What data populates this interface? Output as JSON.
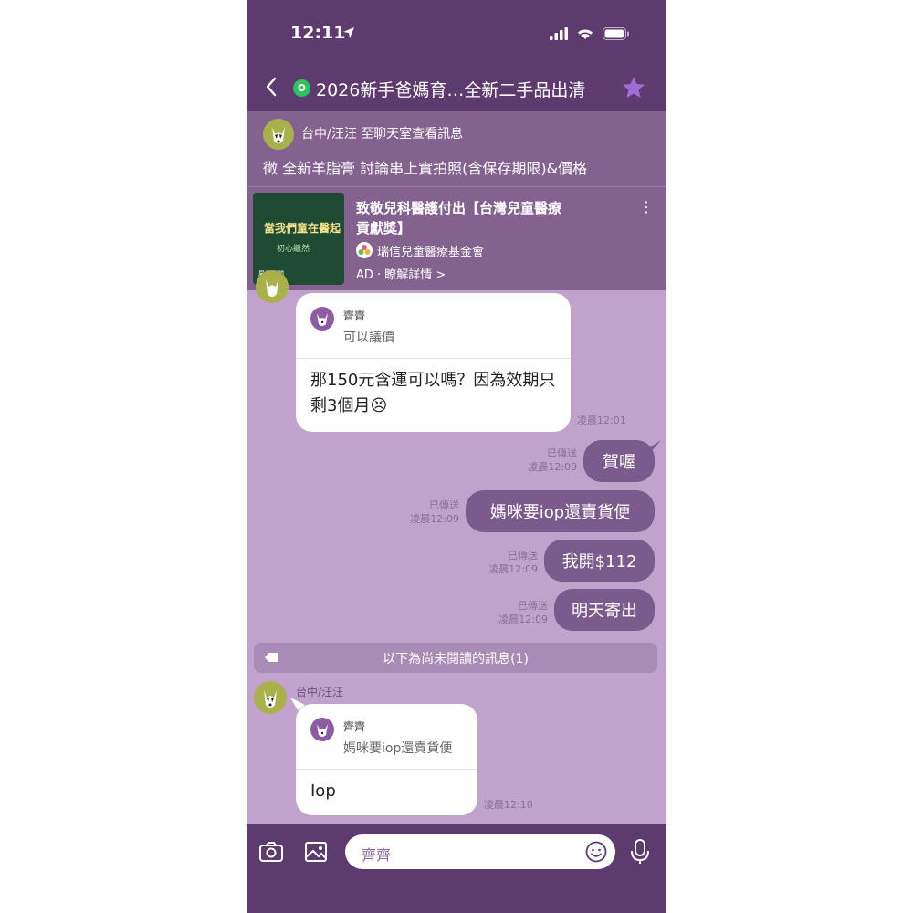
{
  "status_bar": {
    "time": "12:11"
  },
  "header": {
    "title": "2026新手爸媽育…全新二手品出清"
  },
  "announcement": {
    "sender": "台中/汪汪 至聊天室查看訊息",
    "text": "徵 全新羊脂膏 討論串上實拍照(含保存期限)&價格"
  },
  "ad": {
    "thumb_title": "當我們童在醫起",
    "thumb_sub": "初心繼然",
    "thumb_info": "展件期間",
    "headline": "致敬兒科醫護付出【台灣兒童醫療貢獻獎】",
    "sponsor": "瑞信兒童醫療基金會",
    "label": "AD · 瞭解詳情 >",
    "more": "⋮"
  },
  "messages": {
    "m1": {
      "reply_name": "齊齊",
      "reply_text": "可以議價",
      "text": "那150元含運可以嗎？因為效期只剩3個月😣",
      "time": "凌晨12:01"
    },
    "o1": {
      "text": "賀喔",
      "read": "已傳送",
      "time": "凌晨12:09"
    },
    "o2": {
      "text": "媽咪要iop還賣貨便",
      "read": "已傳送",
      "time": "凌晨12:09"
    },
    "o3": {
      "text": "我開$112",
      "read": "已傳送",
      "time": "凌晨12:09"
    },
    "o4": {
      "text": "明天寄出",
      "read": "已傳送",
      "time": "凌晨12:09"
    },
    "unread_divider": "以下為尚未閱讀的訊息(1)",
    "m2": {
      "sender": "台中/汪汪",
      "reply_name": "齊齊",
      "reply_text": "媽咪要iop還賣貨便",
      "text": "Iop",
      "time": "凌晨12:10"
    }
  },
  "input": {
    "placeholder": "齊齊"
  },
  "colors": {
    "header": "#5d3b6e",
    "chat_bg": "#c0a2cd",
    "outgoing_bubble": "#7b5a8d"
  }
}
